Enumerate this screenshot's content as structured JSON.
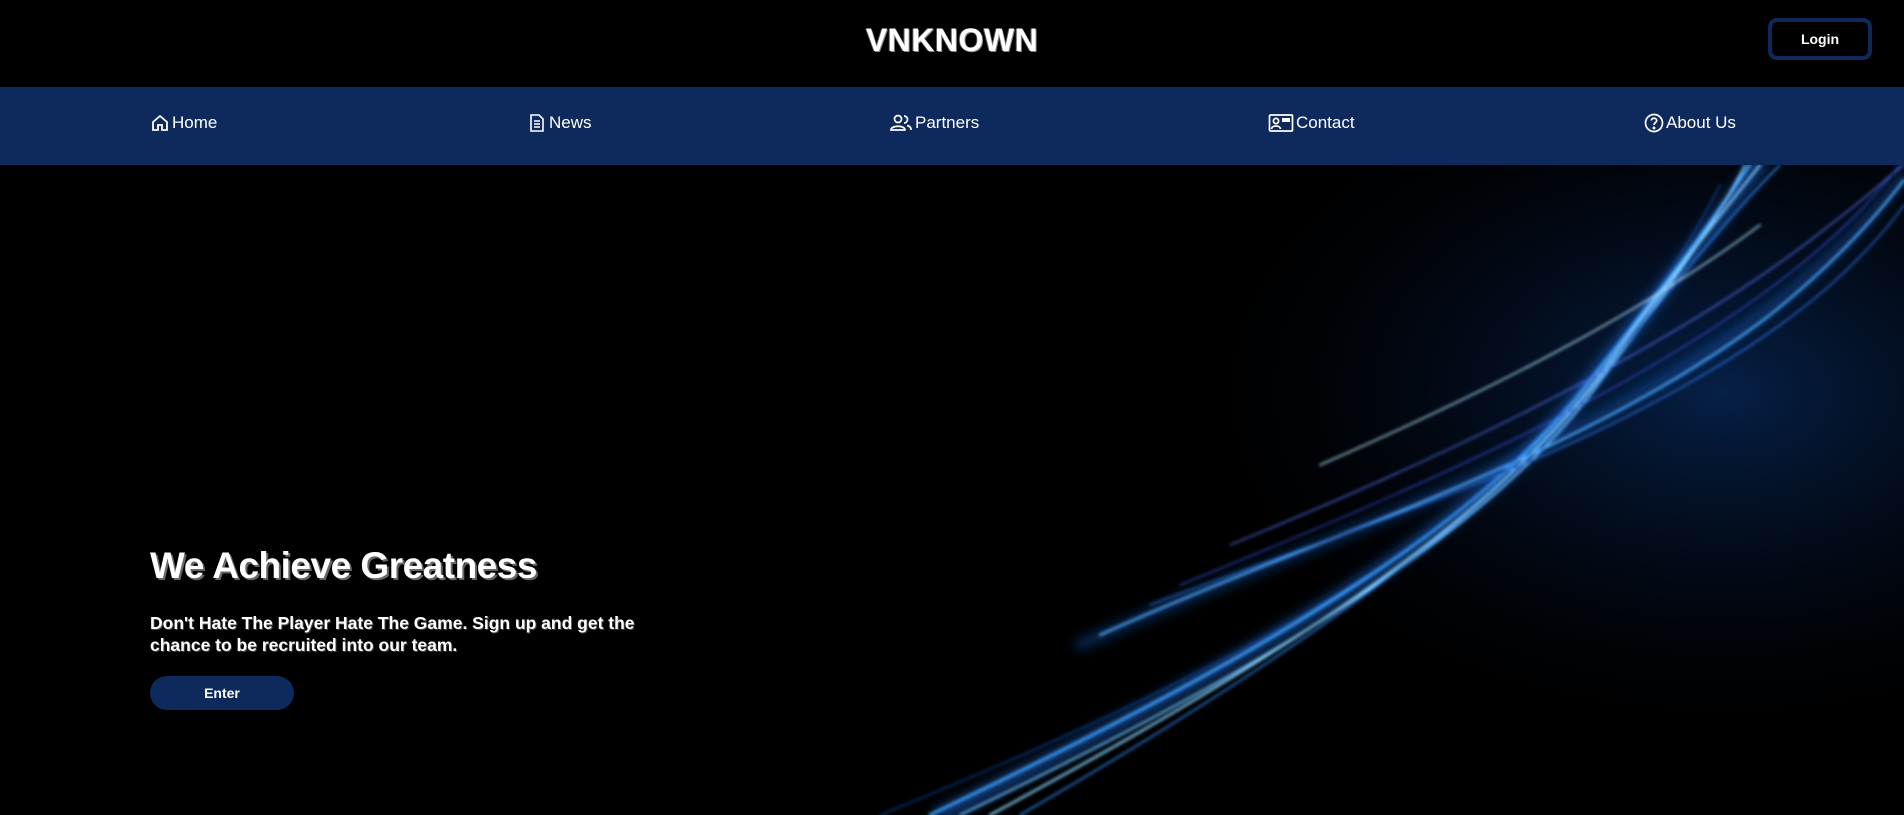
{
  "header": {
    "brand": "VNKNOWN",
    "login_label": "Login"
  },
  "nav": {
    "items": [
      {
        "label": "Home",
        "icon": "home-icon"
      },
      {
        "label": "News",
        "icon": "document-icon"
      },
      {
        "label": "Partners",
        "icon": "users-icon"
      },
      {
        "label": "Contact",
        "icon": "contact-card-icon"
      },
      {
        "label": "About Us",
        "icon": "question-circle-icon"
      }
    ]
  },
  "hero": {
    "title": "We Achieve Greatness",
    "subtitle": "Don't Hate The Player Hate The Game. Sign up and get the chance to be recruited into our team.",
    "enter_label": "Enter"
  },
  "colors": {
    "background": "#000000",
    "nav_background": "#0e2a5c",
    "accent": "#0e2a5c",
    "light_streak": "#2f8bff"
  }
}
